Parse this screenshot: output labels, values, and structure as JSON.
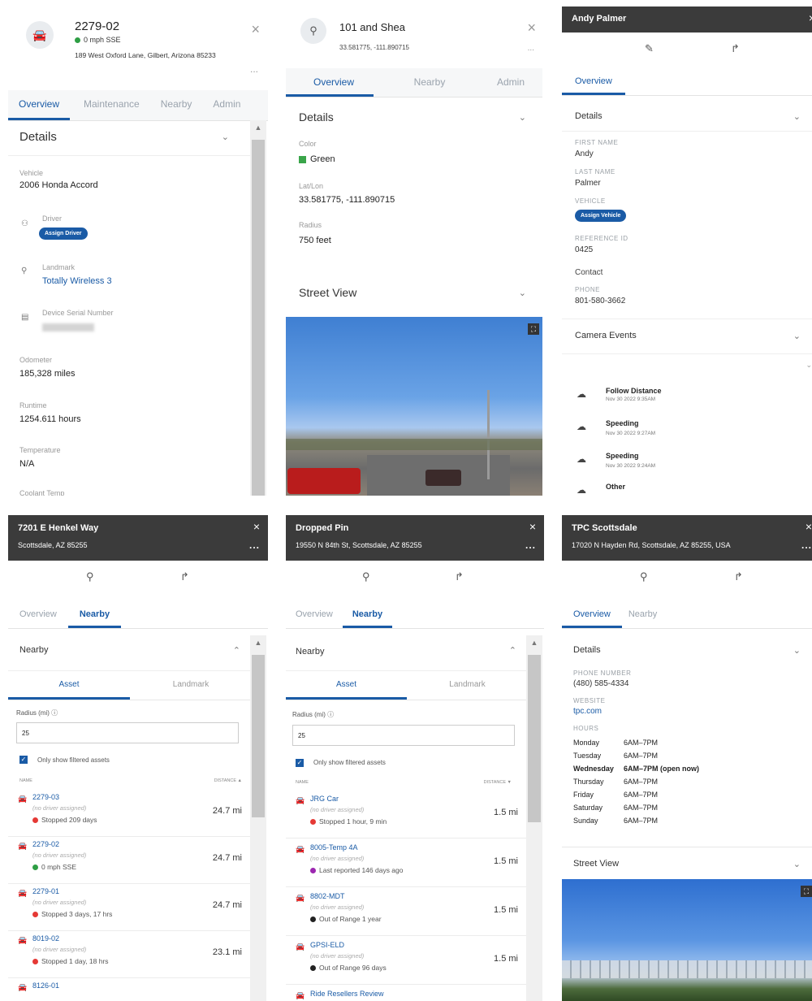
{
  "panel1": {
    "title": "2279-02",
    "speed": "0 mph SSE",
    "address": "189 West Oxford Lane, Gilbert, Arizona 85233",
    "close": "×",
    "more": "...",
    "tabs": [
      "Overview",
      "Maintenance",
      "Nearby",
      "Admin"
    ],
    "details_title": "Details",
    "vehicle_label": "Vehicle",
    "vehicle_value": "2006 Honda Accord",
    "driver_label": "Driver",
    "assign_driver": "Assign Driver",
    "landmark_label": "Landmark",
    "landmark_value": "Totally Wireless 3",
    "serial_label": "Device Serial Number",
    "odometer_label": "Odometer",
    "odometer_value": "185,328 miles",
    "runtime_label": "Runtime",
    "runtime_value": "1254.611 hours",
    "temp_label": "Temperature",
    "temp_value": "N/A",
    "coolant_label": "Coolant Temp",
    "status_color": "#2e9e44"
  },
  "panel2": {
    "title": "101 and Shea",
    "coords": "33.581775, -111.890715",
    "close": "×",
    "more": "...",
    "tabs": [
      "Overview",
      "Nearby",
      "Admin"
    ],
    "details_title": "Details",
    "color_label": "Color",
    "color_value": "Green",
    "color_swatch": "#3aa54a",
    "latlon_label": "Lat/Lon",
    "latlon_value": "33.581775, -111.890715",
    "radius_label": "Radius",
    "radius_value": "750 feet",
    "street_title": "Street View"
  },
  "panel3": {
    "title": "Andy Palmer",
    "close": "×",
    "tab": "Overview",
    "details_title": "Details",
    "first_name_label": "FIRST NAME",
    "first_name": "Andy",
    "last_name_label": "LAST NAME",
    "last_name": "Palmer",
    "vehicle_label": "VEHICLE",
    "assign_vehicle": "Assign Vehicle",
    "ref_label": "REFERENCE ID",
    "ref_value": "0425",
    "contact_label": "Contact",
    "phone_label": "PHONE",
    "phone_value": "801-580-3662",
    "camera_title": "Camera Events",
    "events": [
      {
        "name": "Follow Distance",
        "time": "Nov 30 2022 9:35AM"
      },
      {
        "name": "Speeding",
        "time": "Nov 30 2022 9:27AM"
      },
      {
        "name": "Speeding",
        "time": "Nov 30 2022 9:24AM"
      },
      {
        "name": "Other",
        "time": ""
      }
    ]
  },
  "panel4": {
    "title": "7201 E Henkel Way",
    "subtitle": "Scottsdale, AZ 85255",
    "close": "×",
    "more": "...",
    "tabs": [
      "Overview",
      "Nearby"
    ],
    "nearby_title": "Nearby",
    "subtabs": [
      "Asset",
      "Landmark"
    ],
    "radius_label": "Radius (mi)",
    "radius_value": "25",
    "filter_label": "Only show filtered assets",
    "col_name": "NAME",
    "col_distance": "DISTANCE",
    "rows": [
      {
        "name": "2279-03",
        "driver": "(no driver assigned)",
        "status": "Stopped 209 days",
        "dot": "#e53935",
        "dist": "24.7 mi"
      },
      {
        "name": "2279-02",
        "driver": "(no driver assigned)",
        "status": "0 mph SSE",
        "dot": "#2e9e44",
        "dist": "24.7 mi"
      },
      {
        "name": "2279-01",
        "driver": "(no driver assigned)",
        "status": "Stopped 3 days, 17 hrs",
        "dot": "#e53935",
        "dist": "24.7 mi"
      },
      {
        "name": "8019-02",
        "driver": "(no driver assigned)",
        "status": "Stopped 1 day, 18 hrs",
        "dot": "#e53935",
        "dist": "23.1 mi"
      },
      {
        "name": "8126-01",
        "driver": "",
        "status": "",
        "dot": "",
        "dist": ""
      }
    ]
  },
  "panel5": {
    "title": "Dropped Pin",
    "subtitle": "19550 N 84th St, Scottsdale, AZ 85255",
    "close": "×",
    "more": "...",
    "tabs": [
      "Overview",
      "Nearby"
    ],
    "nearby_title": "Nearby",
    "subtabs": [
      "Asset",
      "Landmark"
    ],
    "radius_label": "Radius (mi)",
    "radius_value": "25",
    "filter_label": "Only show filtered assets",
    "col_name": "NAME",
    "col_distance": "DISTANCE",
    "rows": [
      {
        "name": "JRG Car",
        "driver": "(no driver assigned)",
        "status": "Stopped 1 hour, 9 min",
        "dot": "#e53935",
        "dist": "1.5 mi"
      },
      {
        "name": "8005-Temp 4A",
        "driver": "(no driver assigned)",
        "status": "Last reported 146 days ago",
        "dot": "#9c27b0",
        "dist": "1.5 mi"
      },
      {
        "name": "8802-MDT",
        "driver": "(no driver assigned)",
        "status": "Out of Range 1 year",
        "dot": "#222222",
        "dist": "1.5 mi"
      },
      {
        "name": "GPSI-ELD",
        "driver": "(no driver assigned)",
        "status": "Out of Range 96 days",
        "dot": "#222222",
        "dist": "1.5 mi"
      },
      {
        "name": "Ride Resellers Review",
        "driver": "",
        "status": "",
        "dot": "",
        "dist": ""
      }
    ]
  },
  "panel6": {
    "title": "TPC Scottsdale",
    "subtitle": "17020 N Hayden Rd, Scottsdale, AZ 85255, USA",
    "close": "×",
    "more": "...",
    "tabs": [
      "Overview",
      "Nearby"
    ],
    "details_title": "Details",
    "phone_label": "PHONE NUMBER",
    "phone_value": "(480) 585-4334",
    "website_label": "WEBSITE",
    "website_value": "tpc.com",
    "hours_label": "HOURS",
    "hours": [
      {
        "day": "Monday",
        "time": "6AM–7PM"
      },
      {
        "day": "Tuesday",
        "time": "6AM–7PM"
      },
      {
        "day": "Wednesday",
        "time": "6AM–7PM (open now)"
      },
      {
        "day": "Thursday",
        "time": "6AM–7PM"
      },
      {
        "day": "Friday",
        "time": "6AM–7PM"
      },
      {
        "day": "Saturday",
        "time": "6AM–7PM"
      },
      {
        "day": "Sunday",
        "time": "6AM–7PM"
      }
    ],
    "street_title": "Street View"
  }
}
